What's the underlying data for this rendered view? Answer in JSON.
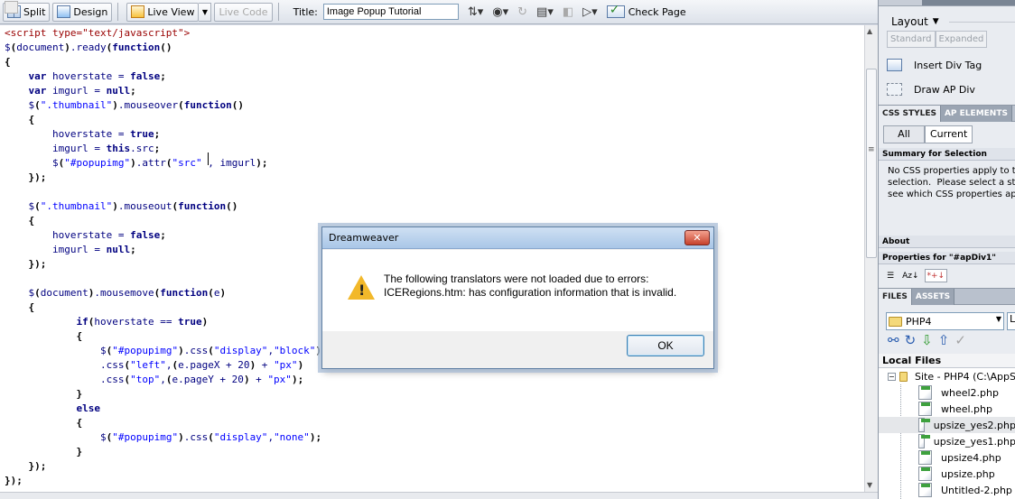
{
  "toolbar": {
    "split_label": "Split",
    "design_label": "Design",
    "live_view_label": "Live View",
    "live_code_label": "Live Code",
    "title_label": "Title:",
    "title_value": "Image Popup Tutorial",
    "check_page_label": "Check Page"
  },
  "editor": {
    "lines": [
      "<script type=\"text/javascript\">",
      "$(document).ready(function()",
      "{",
      "    var hoverstate = false;",
      "    var imgurl = null;",
      "    $(\".thumbnail\").mouseover(function()",
      "    {",
      "        hoverstate = true;",
      "        imgurl = this.src;",
      "        $(\"#popupimg\").attr(\"src\" , imgurl);",
      "    });",
      "",
      "    $(\".thumbnail\").mouseout(function()",
      "    {",
      "        hoverstate = false;",
      "        imgurl = null;",
      "    });",
      "",
      "    $(document).mousemove(function(e)",
      "    {",
      "            if(hoverstate == true)",
      "            {",
      "                $(\"#popupimg\").css(\"display\",\"block\")",
      "                .css(\"left\",(e.pageX + 20) + \"px\")",
      "                .css(\"top\",(e.pageY + 20) + \"px\");",
      "            }",
      "            else",
      "            {",
      "                $(\"#popupimg\").css(\"display\",\"none\");",
      "            }",
      "    });",
      "});"
    ]
  },
  "panel": {
    "layout_label": "Layout",
    "standard_label": "Standard",
    "expanded_label": "Expanded",
    "insert_div_label": "Insert Div Tag",
    "draw_ap_label": "Draw AP Div",
    "css_tab": "CSS STYLES",
    "ap_tab": "AP ELEMENTS",
    "all_label": "All",
    "current_label": "Current",
    "summary_head": "Summary for Selection",
    "summary_text": "No CSS properties apply to th\nselection.  Please select a sty\nsee which CSS properties app",
    "about_head": "About",
    "properties_head": "Properties for \"#apDiv1\"",
    "files_tab": "FILES",
    "assets_tab": "ASSETS",
    "site_name": "PHP4",
    "second_select": "L",
    "local_files_label": "Local Files",
    "site_root": "Site - PHP4 (C:\\AppS",
    "files": [
      "wheel2.php",
      "wheel.php",
      "upsize_yes2.php",
      "upsize_yes1.php",
      "upsize4.php",
      "upsize.php",
      "Untitled-2.php"
    ]
  },
  "dialog": {
    "title": "Dreamweaver",
    "message_line1": "The following translators were not loaded due to errors:",
    "message_line2": "ICERegions.htm: has configuration information that is invalid.",
    "ok_label": "OK",
    "close_symbol": "✕"
  }
}
